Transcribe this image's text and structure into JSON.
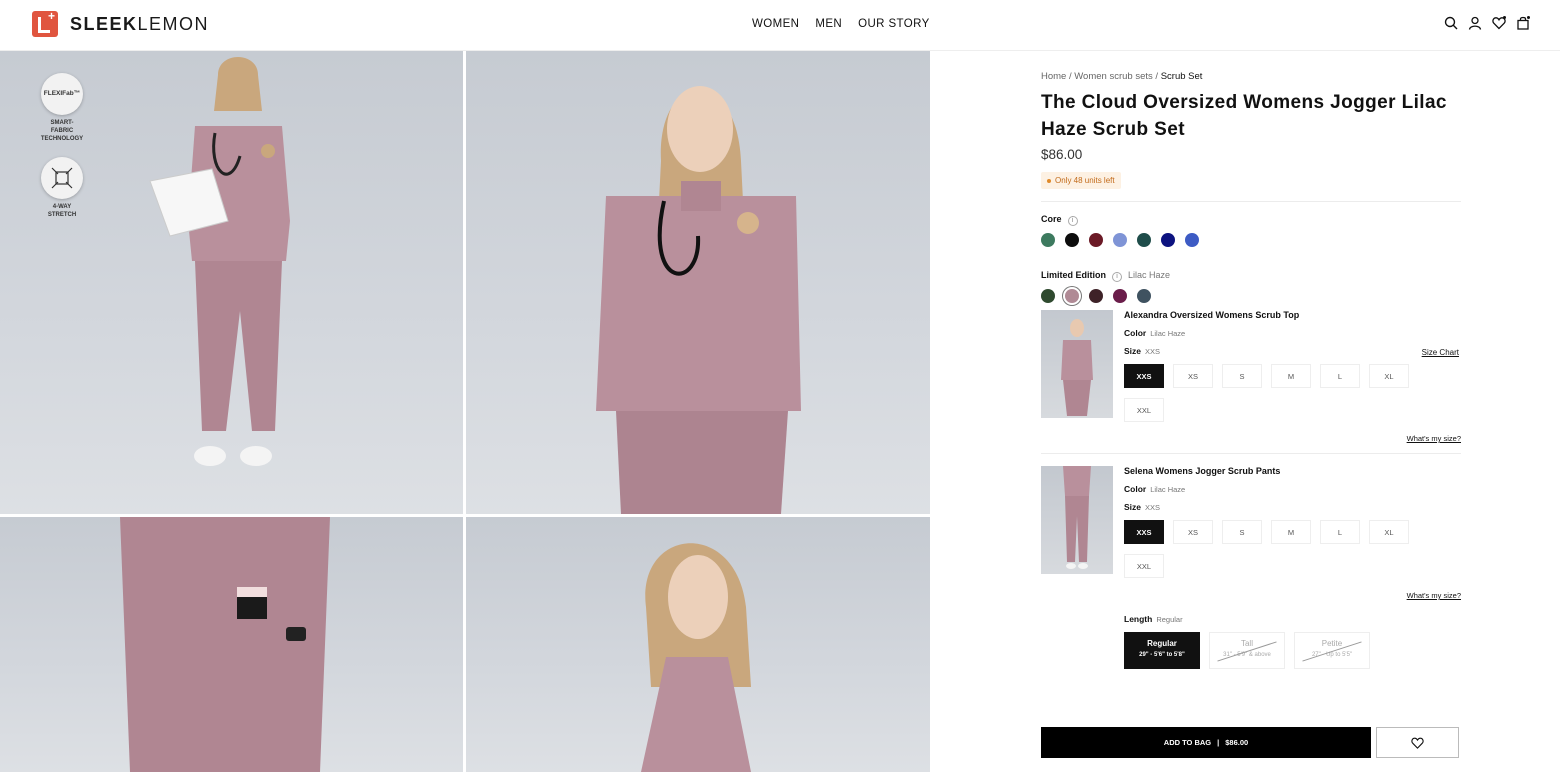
{
  "brand": {
    "name_bold": "SLEEK",
    "name_rest": "LEMON",
    "accent": "#e0553f"
  },
  "nav": [
    "WOMEN",
    "MEN",
    "OUR STORY"
  ],
  "header_icons": [
    "search-icon",
    "account-icon",
    "wishlist-icon",
    "bag-icon"
  ],
  "badges": [
    {
      "title": "FLEXIFab™",
      "caption": "SMART-FABRIC TECHNOLOGY"
    },
    {
      "title": "",
      "caption": "4-WAY STRETCH"
    }
  ],
  "breadcrumb": {
    "home": "Home",
    "sep": "/",
    "category": "Women scrub sets",
    "current": "Scrub Set"
  },
  "product": {
    "title": "The Cloud Oversized Womens Jogger Lilac Haze Scrub Set",
    "price": "$86.00",
    "stock": "Only 48 units left"
  },
  "core": {
    "label": "Core",
    "colors": [
      "#3d7a5f",
      "#0d0d0d",
      "#6b1a26",
      "#7f94d6",
      "#1f4d4a",
      "#0d1380",
      "#3d5bc4"
    ]
  },
  "limited": {
    "label": "Limited Edition",
    "selected": "Lilac Haze",
    "colors": [
      "#2f4a2f",
      "#b08a95",
      "#3e2228",
      "#6a1d4a",
      "#3f5260"
    ]
  },
  "items": [
    {
      "name": "Alexandra Oversized Womens Scrub Top",
      "color_label": "Color",
      "color": "Lilac Haze",
      "size_label": "Size",
      "size": "XXS",
      "size_chart": "Size Chart",
      "sizes": [
        "XXS",
        "XS",
        "S",
        "M",
        "L",
        "XL",
        "XXL"
      ],
      "whats": "What's my size?"
    },
    {
      "name": "Selena Womens Jogger Scrub Pants",
      "color_label": "Color",
      "color": "Lilac Haze",
      "size_label": "Size",
      "size": "XXS",
      "sizes": [
        "XXS",
        "XS",
        "S",
        "M",
        "L",
        "XL",
        "XXL"
      ],
      "whats": "What's my size?"
    }
  ],
  "length": {
    "label": "Length",
    "value": "Regular",
    "options": [
      {
        "name": "Regular",
        "desc": "29\" - 5'6\" to 5'8\""
      },
      {
        "name": "Tall",
        "desc": "31\" - 5'9\" & above"
      },
      {
        "name": "Petite",
        "desc": "27\" - Up to 5'5\""
      }
    ]
  },
  "cta": {
    "label": "ADD TO BAG",
    "sep": "|",
    "price": "$86.00"
  }
}
